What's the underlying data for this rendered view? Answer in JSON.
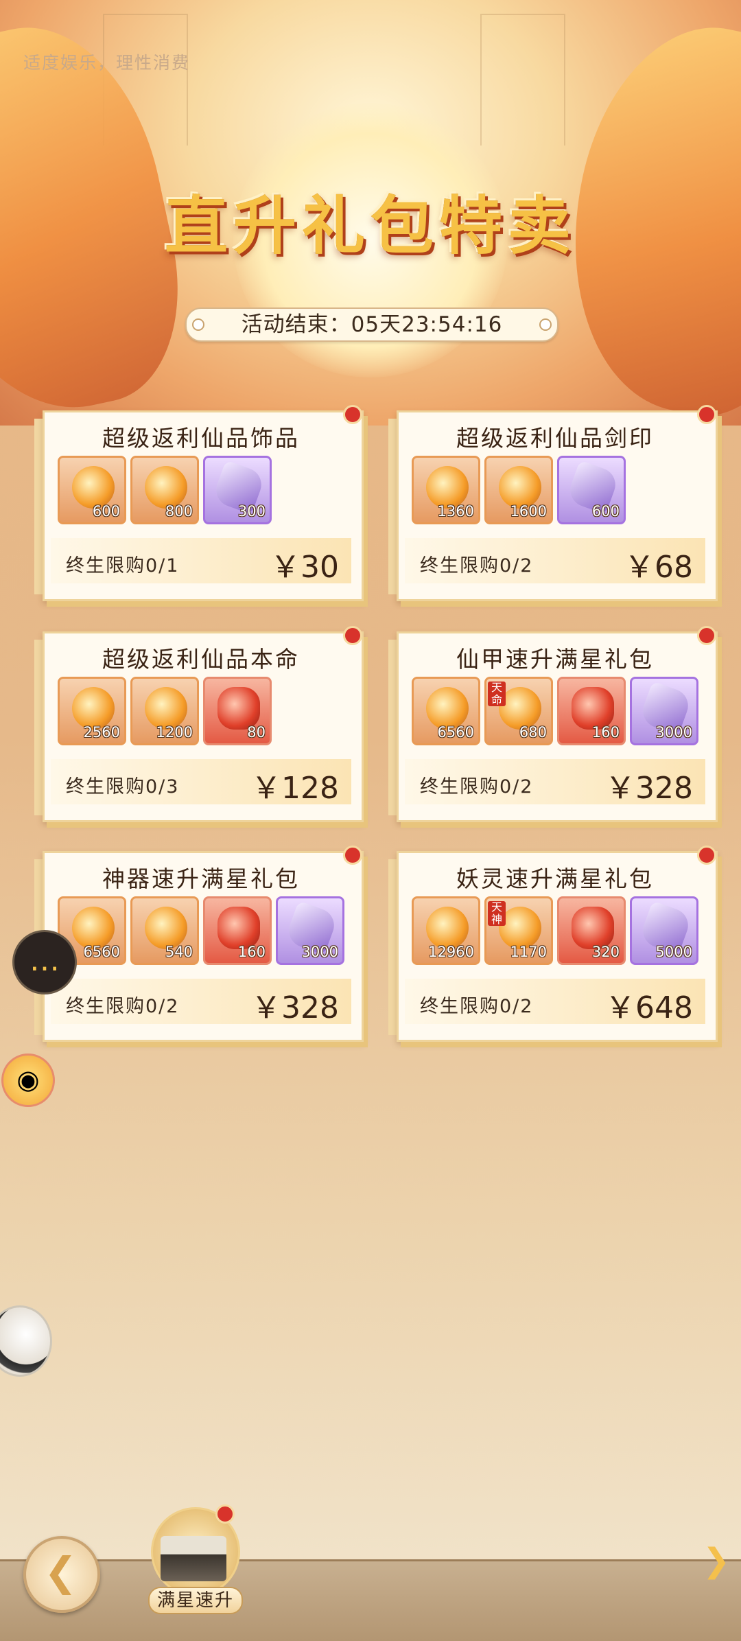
{
  "header": {
    "notice": "适度娱乐，理性消费",
    "title": "直升礼包特卖",
    "timer": "活动结束：05天23:54:16"
  },
  "colors": {
    "pin": "#d8332b",
    "title_gold": "#f6c145",
    "card_bg": "#fffaf0"
  },
  "packs": [
    {
      "title": "超级返利仙品饰品",
      "limit": "终生限购0/1",
      "price": "￥30",
      "items": [
        {
          "qty": "600",
          "style": "orange"
        },
        {
          "qty": "800",
          "style": "orange"
        },
        {
          "qty": "300",
          "style": "purple"
        }
      ]
    },
    {
      "title": "超级返利仙品剑印",
      "limit": "终生限购0/2",
      "price": "￥68",
      "items": [
        {
          "qty": "1360",
          "style": "orange"
        },
        {
          "qty": "1600",
          "style": "orange"
        },
        {
          "qty": "600",
          "style": "purple"
        }
      ]
    },
    {
      "title": "超级返利仙品本命",
      "limit": "终生限购0/3",
      "price": "￥128",
      "items": [
        {
          "qty": "2560",
          "style": "orange"
        },
        {
          "qty": "1200",
          "style": "orange"
        },
        {
          "qty": "80",
          "style": "red"
        }
      ]
    },
    {
      "title": "仙甲速升满星礼包",
      "limit": "终生限购0/2",
      "price": "￥328",
      "items": [
        {
          "qty": "6560",
          "style": "orange"
        },
        {
          "qty": "680",
          "style": "orange",
          "tag": "天命"
        },
        {
          "qty": "160",
          "style": "red"
        },
        {
          "qty": "3000",
          "style": "purple"
        }
      ]
    },
    {
      "title": "神器速升满星礼包",
      "limit": "终生限购0/2",
      "price": "￥328",
      "items": [
        {
          "qty": "6560",
          "style": "orange"
        },
        {
          "qty": "540",
          "style": "orange"
        },
        {
          "qty": "160",
          "style": "red"
        },
        {
          "qty": "3000",
          "style": "purple"
        }
      ]
    },
    {
      "title": "妖灵速升满星礼包",
      "limit": "终生限购0/2",
      "price": "￥648",
      "items": [
        {
          "qty": "12960",
          "style": "orange"
        },
        {
          "qty": "1170",
          "style": "orange",
          "tag": "天神"
        },
        {
          "qty": "320",
          "style": "red"
        },
        {
          "qty": "5000",
          "style": "purple"
        }
      ]
    }
  ],
  "bottom": {
    "tab_label": "满星速升",
    "back_icon": "back-arrow-icon",
    "next_icon": "next-arrow-icon"
  },
  "side_buttons": {
    "chat_icon": "chat-bubble-icon",
    "pet_icon": "pet-icon",
    "avatar_icon": "avatar-icon"
  }
}
